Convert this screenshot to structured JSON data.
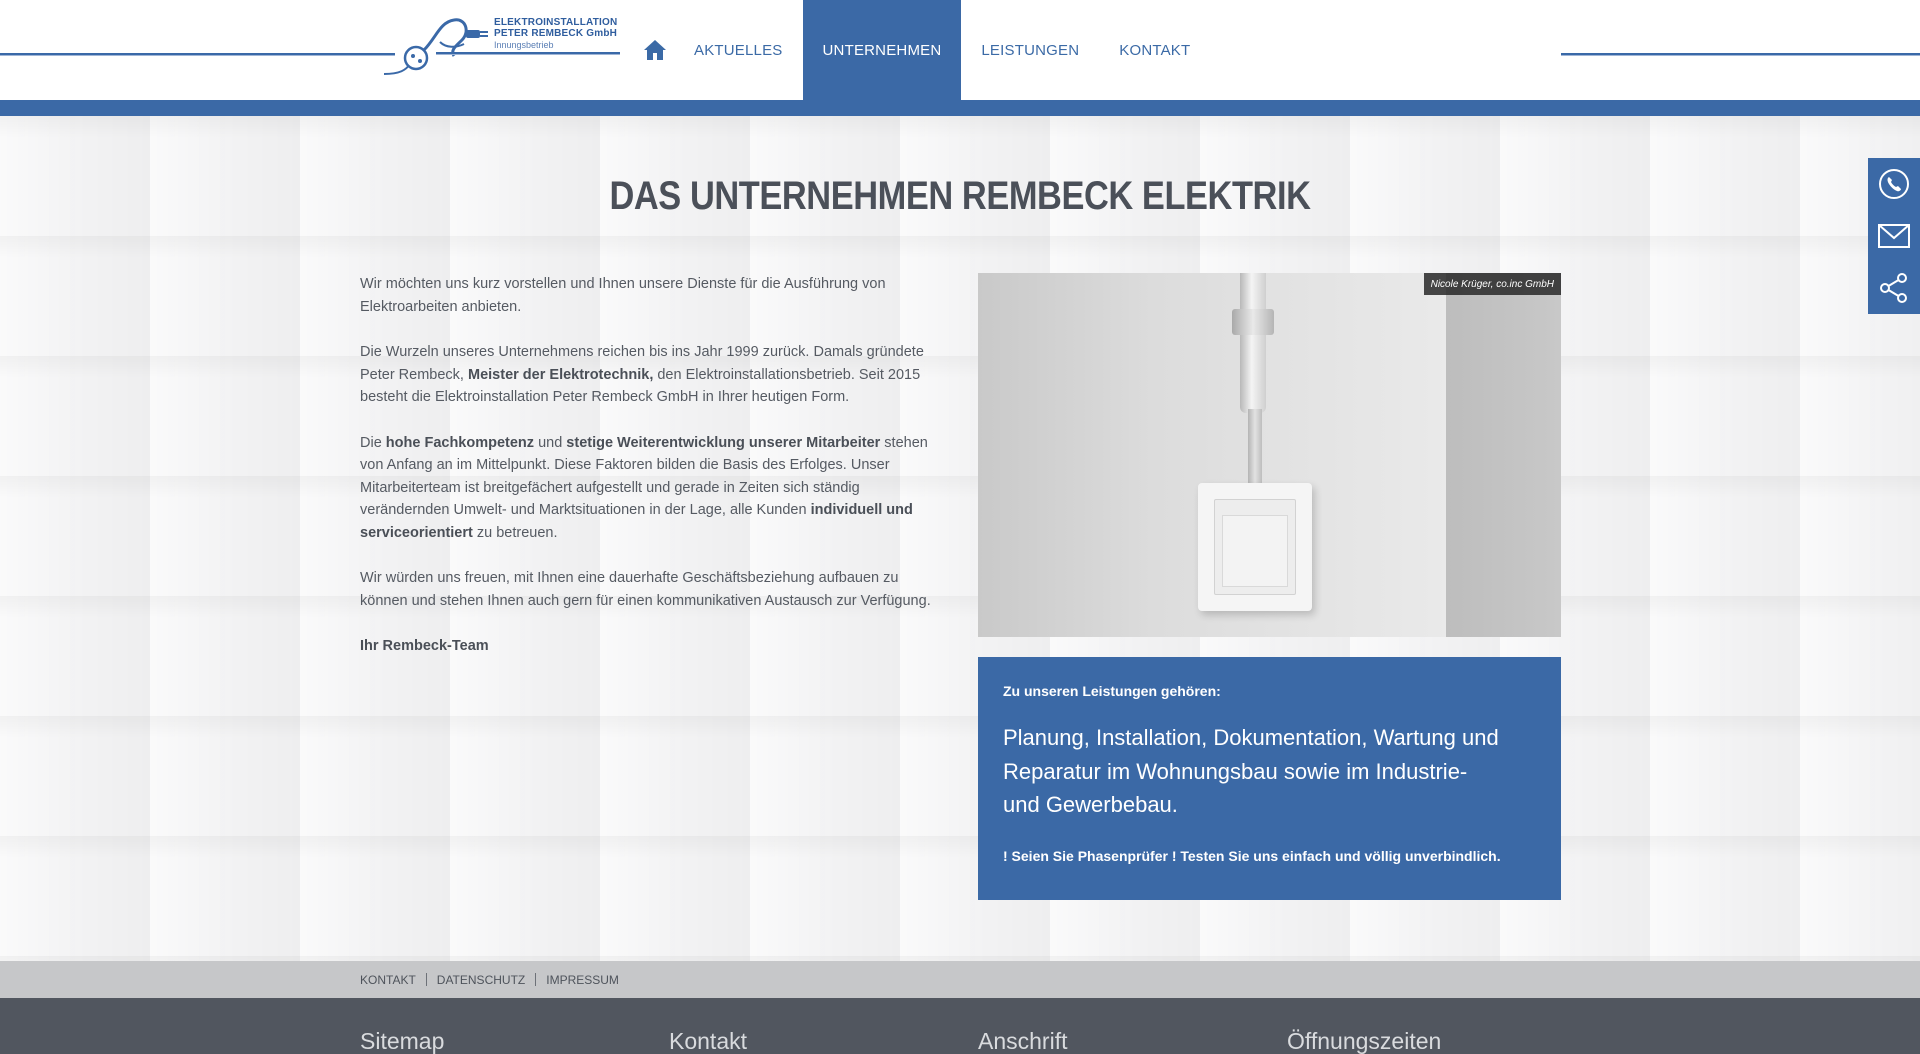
{
  "header": {
    "logo": {
      "line1": "ELEKTROINSTALLATION",
      "line2": "PETER REMBECK GmbH",
      "line3": "Innungsbetrieb"
    },
    "nav": [
      {
        "label": "AKTUELLES",
        "active": false
      },
      {
        "label": "UNTERNEHMEN",
        "active": true
      },
      {
        "label": "LEISTUNGEN",
        "active": false
      },
      {
        "label": "KONTAKT",
        "active": false
      }
    ]
  },
  "side_bar": {
    "icons": [
      "phone-icon",
      "mail-icon",
      "share-icon"
    ]
  },
  "main": {
    "title": "DAS UNTERNEHMEN REMBECK ELEKTRIK",
    "paragraphs": {
      "p1": "Wir möchten uns kurz vorstellen und Ihnen unsere Dienste für die Ausführung von Elektroarbeiten anbieten.",
      "p2_a": "Die Wurzeln unseres Unternehmens reichen bis ins Jahr 1999 zurück. Damals gründete Peter Rembeck, ",
      "p2_b": "Meister der Elektrotechnik,",
      "p2_c": " den Elektroinstallationsbetrieb. Seit 2015 besteht die Elektroinstallation Peter Rembeck GmbH in Ihrer heutigen Form.",
      "p3_a": "Die ",
      "p3_b": "hohe Fachkompetenz",
      "p3_c": " und ",
      "p3_d": "stetige Weiterentwicklung unserer Mitarbeiter",
      "p3_e": " stehen von Anfang an im Mittelpunkt. Diese Faktoren bilden die Basis des Erfolges. Unser Mitarbeiterteam ist breitgefächert aufgestellt und gerade in Zeiten sich ständig verändernden Umwelt- und Marktsituationen in der Lage, alle Kunden ",
      "p3_f": "individuell und serviceorientiert",
      "p3_g": " zu betreuen.",
      "p4": "Wir würden uns freuen, mit Ihnen eine dauerhafte Geschäftsbeziehung aufbauen zu können und stehen Ihnen auch gern für einen kommunikativen Austausch zur Verfügung.",
      "signature": "Ihr Rembeck-Team"
    },
    "photo_credit": "Nicole Krüger, co.inc GmbH",
    "info_box": {
      "heading": "Zu unseren Leistungen gehören:",
      "main": "Planung, Installation, Dokumentation, Wartung und Reparatur im Wohnungsbau sowie im Industrie- und Gewerbebau.",
      "footer": "! Seien Sie Phasenprüfer ! Testen Sie uns einfach und völlig unverbindlich."
    }
  },
  "footer": {
    "links": [
      "KONTAKT",
      "DATENSCHUTZ",
      "IMPRESSUM"
    ],
    "columns": [
      "Sitemap",
      "Kontakt",
      "Anschrift",
      "Öffnungszeiten"
    ]
  },
  "colors": {
    "brand_blue": "#3b69a6",
    "footer_dark": "#51565f",
    "footer_light": "#c6c7c9"
  }
}
